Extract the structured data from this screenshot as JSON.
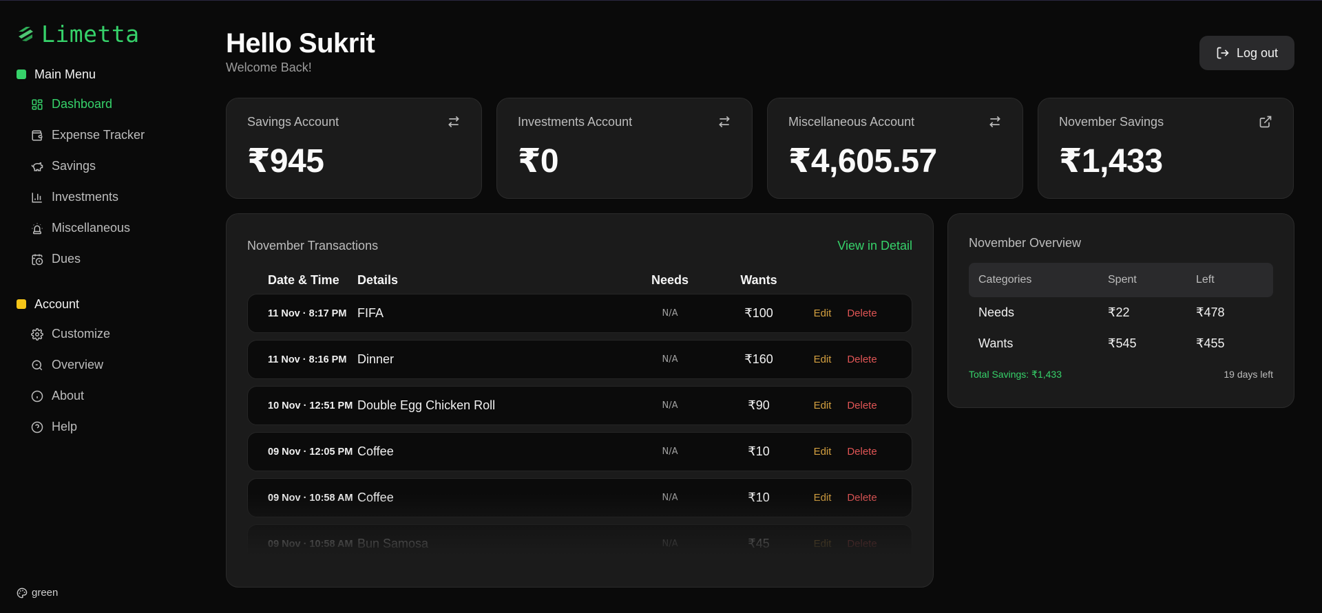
{
  "app": {
    "name": "Limetta",
    "accent": "#36d26a"
  },
  "sidebar": {
    "main_menu": {
      "label": "Main Menu",
      "color": "#36d26a",
      "items": [
        {
          "label": "Dashboard",
          "icon": "grid-icon",
          "active": true
        },
        {
          "label": "Expense Tracker",
          "icon": "wallet-icon"
        },
        {
          "label": "Savings",
          "icon": "piggy-bank-icon"
        },
        {
          "label": "Investments",
          "icon": "bar-chart-icon"
        },
        {
          "label": "Miscellaneous",
          "icon": "siren-icon"
        },
        {
          "label": "Dues",
          "icon": "calendar-clock-icon"
        }
      ]
    },
    "account": {
      "label": "Account",
      "color": "#f5c518",
      "items": [
        {
          "label": "Customize",
          "icon": "gear-icon"
        },
        {
          "label": "Overview",
          "icon": "search-icon"
        },
        {
          "label": "About",
          "icon": "info-icon"
        },
        {
          "label": "Help",
          "icon": "help-circle-icon"
        }
      ]
    },
    "theme": {
      "label": "green",
      "icon": "palette-icon"
    }
  },
  "header": {
    "title": "Hello Sukrit",
    "subtitle": "Welcome Back!",
    "logout_label": "Log out"
  },
  "cards": [
    {
      "label": "Savings Account",
      "value": "₹945",
      "icon": "transfer-icon"
    },
    {
      "label": "Investments Account",
      "value": "₹0",
      "icon": "transfer-icon"
    },
    {
      "label": "Miscellaneous Account",
      "value": "₹4,605.57",
      "icon": "transfer-icon"
    },
    {
      "label": "November Savings",
      "value": "₹1,433",
      "icon": "external-link-icon"
    }
  ],
  "transactions": {
    "title": "November Transactions",
    "view_detail": "View in Detail",
    "columns": {
      "date": "Date & Time",
      "details": "Details",
      "needs": "Needs",
      "wants": "Wants"
    },
    "edit_label": "Edit",
    "delete_label": "Delete",
    "rows": [
      {
        "date": "11 Nov · 8:17 PM",
        "details": "FIFA",
        "needs": "N/A",
        "wants": "₹100"
      },
      {
        "date": "11 Nov · 8:16 PM",
        "details": "Dinner",
        "needs": "N/A",
        "wants": "₹160"
      },
      {
        "date": "10 Nov · 12:51 PM",
        "details": "Double Egg Chicken Roll",
        "needs": "N/A",
        "wants": "₹90"
      },
      {
        "date": "09 Nov · 12:05 PM",
        "details": "Coffee",
        "needs": "N/A",
        "wants": "₹10"
      },
      {
        "date": "09 Nov · 10:58 AM",
        "details": "Coffee",
        "needs": "N/A",
        "wants": "₹10"
      },
      {
        "date": "09 Nov · 10:58 AM",
        "details": "Bun Samosa",
        "needs": "N/A",
        "wants": "₹45"
      }
    ]
  },
  "overview": {
    "title": "November Overview",
    "columns": {
      "category": "Categories",
      "spent": "Spent",
      "left": "Left"
    },
    "rows": [
      {
        "category": "Needs",
        "spent": "₹22",
        "left": "₹478"
      },
      {
        "category": "Wants",
        "spent": "₹545",
        "left": "₹455"
      }
    ],
    "total_savings": "Total Savings: ₹1,433",
    "days_left": "19 days left"
  }
}
